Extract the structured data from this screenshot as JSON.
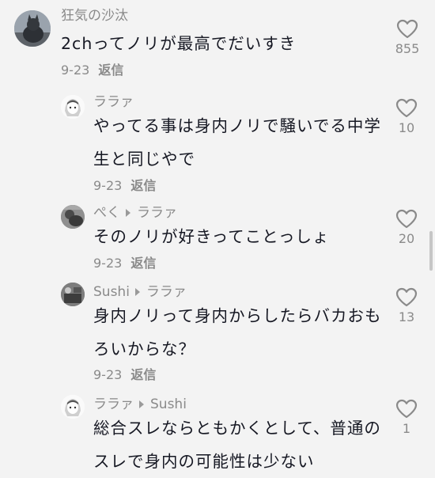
{
  "comments": [
    {
      "user": "狂気の沙汰",
      "text": "2chってノリが最高でだいすき",
      "date": "9-23",
      "reply_label": "返信",
      "likes": "855",
      "avatar_icon": "cat-photo-avatar"
    },
    {
      "user": "ララァ",
      "text": "やってる事は身内ノリで騒いでる中学生と同じやで",
      "date": "9-23",
      "reply_label": "返信",
      "likes": "10",
      "avatar_icon": "anime-girl-avatar"
    },
    {
      "user": "ぺく",
      "reply_to": "ララァ",
      "text": "そのノリが好きってことっしょ",
      "date": "9-23",
      "reply_label": "返信",
      "likes": "20",
      "avatar_icon": "photo-avatar"
    },
    {
      "user": "Sushi",
      "reply_to": "ララァ",
      "text": "身内ノリって身内からしたらバカおもろいからな？",
      "date": "9-23",
      "reply_label": "返信",
      "likes": "13",
      "avatar_icon": "photo-avatar"
    },
    {
      "user": "ララァ",
      "reply_to": "Sushi",
      "text": "総合スレならともかくとして、普通のスレで身内の可能性は少ない",
      "likes": "1",
      "avatar_icon": "anime-girl-avatar"
    }
  ],
  "colors": {
    "background": "#f3f3f3",
    "text": "#161823",
    "secondary": "#8a8a8a"
  }
}
